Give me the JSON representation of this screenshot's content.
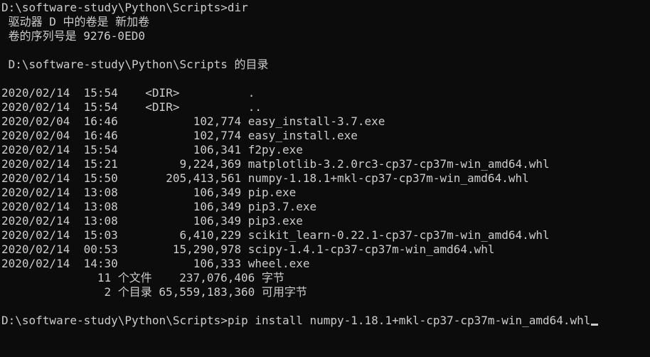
{
  "terminal": {
    "colors": {
      "background": "#0c0c0c",
      "foreground": "#cccccc"
    },
    "command_prompt": "D:\\software-study\\Python\\Scripts>dir",
    "volume_line": " 驱动器 D 中的卷是 新加卷",
    "serial_line": " 卷的序列号是 9276-0ED0",
    "blank_1": "",
    "directory_header": " D:\\software-study\\Python\\Scripts 的目录",
    "blank_2": "",
    "entries": [
      {
        "text": "2020/02/14  15:54    <DIR>          ."
      },
      {
        "text": "2020/02/14  15:54    <DIR>          .."
      },
      {
        "text": "2020/02/04  16:46           102,774 easy_install-3.7.exe"
      },
      {
        "text": "2020/02/04  16:46           102,774 easy_install.exe"
      },
      {
        "text": "2020/02/14  15:54           106,341 f2py.exe"
      },
      {
        "text": "2020/02/14  15:21         9,224,369 matplotlib-3.2.0rc3-cp37-cp37m-win_amd64.whl"
      },
      {
        "text": "2020/02/14  15:50       205,413,561 numpy-1.18.1+mkl-cp37-cp37m-win_amd64.whl"
      },
      {
        "text": "2020/02/14  13:08           106,349 pip.exe"
      },
      {
        "text": "2020/02/14  13:08           106,349 pip3.7.exe"
      },
      {
        "text": "2020/02/14  13:08           106,349 pip3.exe"
      },
      {
        "text": "2020/02/14  15:03         6,410,229 scikit_learn-0.22.1-cp37-cp37m-win_amd64.whl"
      },
      {
        "text": "2020/02/14  00:53        15,290,978 scipy-1.4.1-cp37-cp37m-win_amd64.whl"
      },
      {
        "text": "2020/02/14  14:30           106,333 wheel.exe"
      }
    ],
    "summary_files": "              11 个文件    237,076,406 字节",
    "summary_dirs": "               2 个目录 65,559,183,360 可用字节",
    "blank_3": "",
    "current_input": "D:\\software-study\\Python\\Scripts>pip install numpy-1.18.1+mkl-cp37-cp37m-win_amd64.whl"
  }
}
